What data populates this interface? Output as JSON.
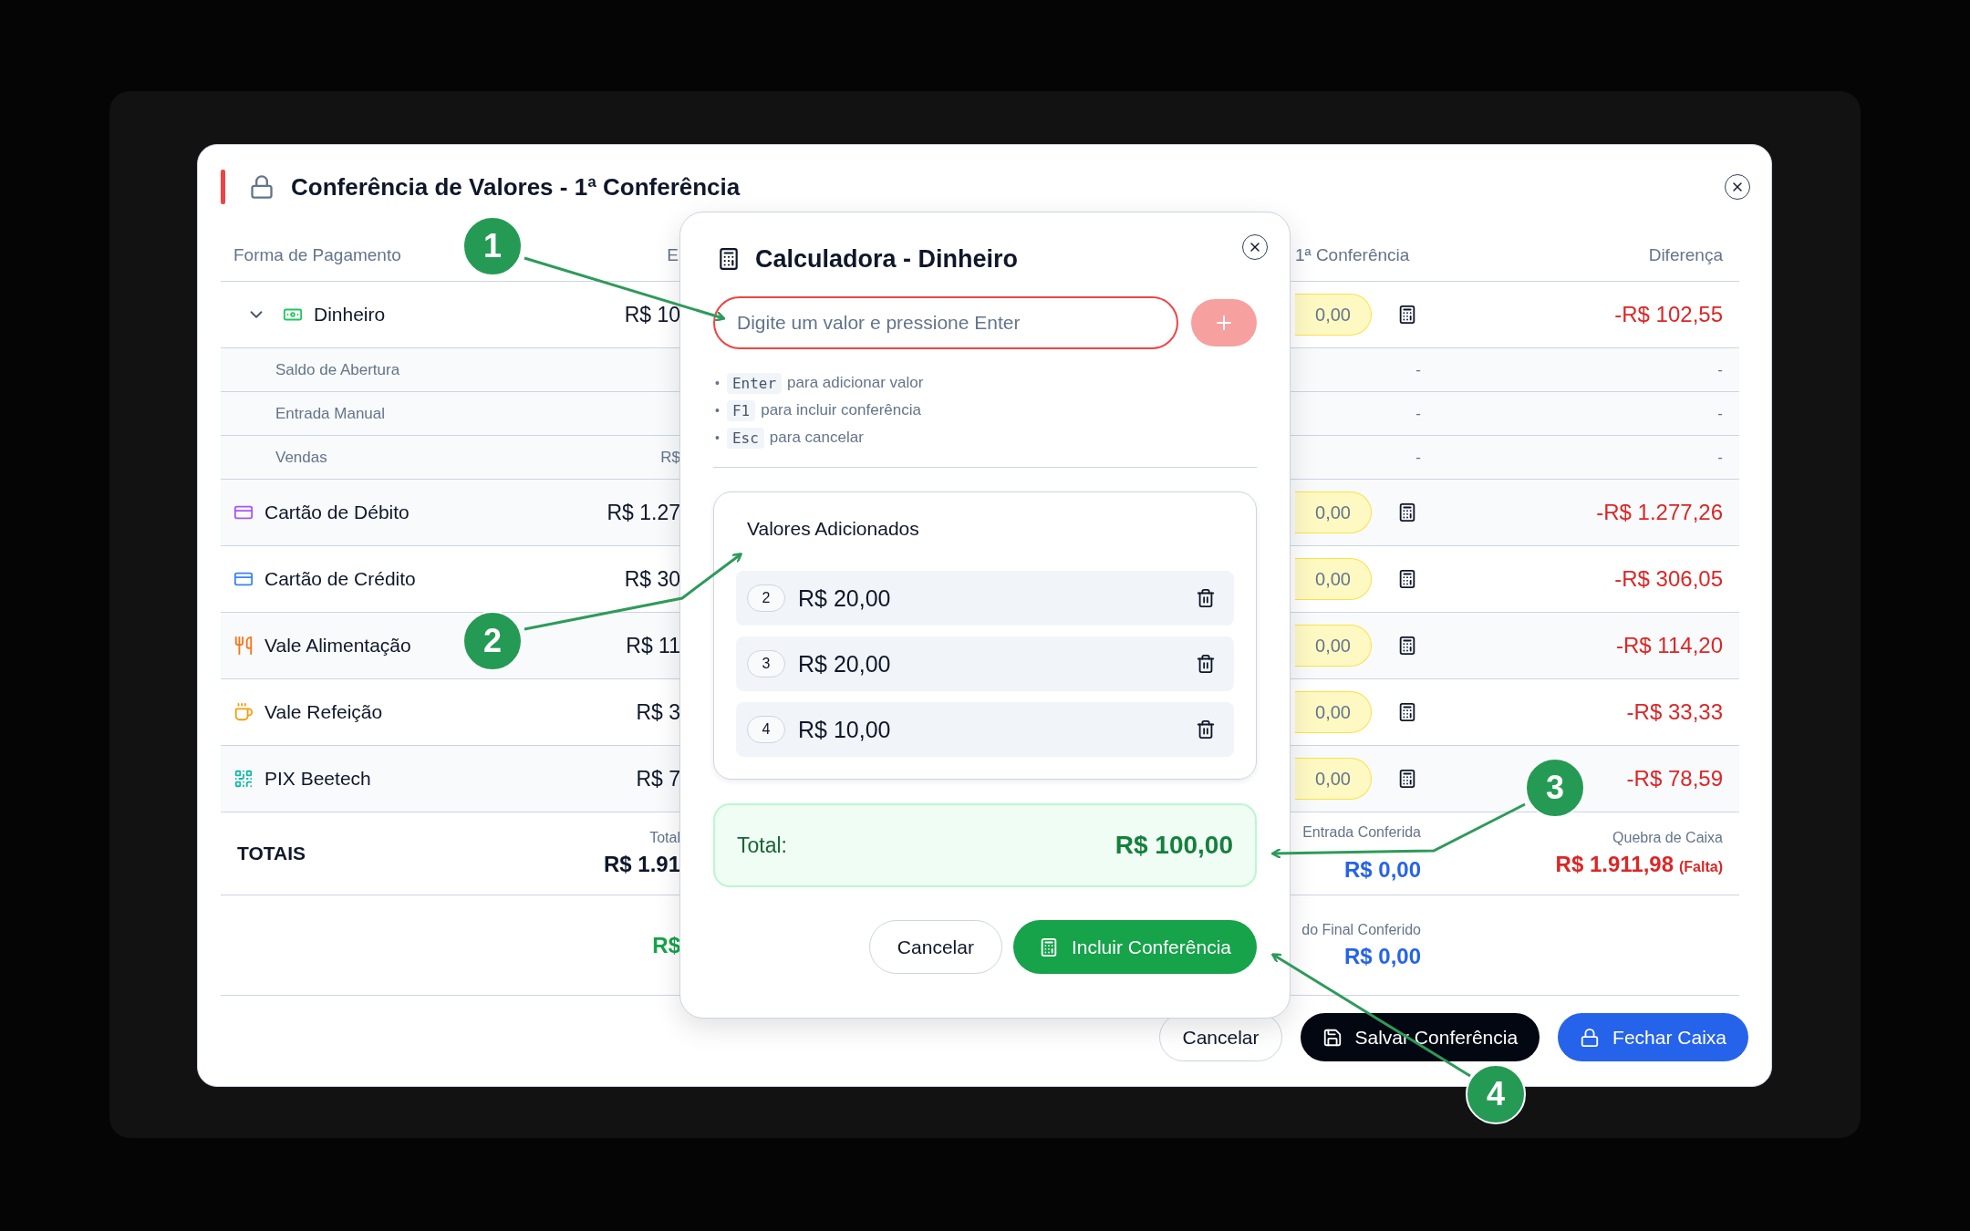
{
  "dialog": {
    "title": "Conferência de Valores - 1ª Conferência"
  },
  "table": {
    "columns": [
      {
        "label": "Forma de Pagamento"
      },
      {
        "label": "E"
      },
      {
        "label": "1ª Conferência"
      },
      {
        "label": "Diferença"
      }
    ],
    "rows": [
      {
        "kind": "method",
        "name": "Dinheiro",
        "color": "#22c55e",
        "expanded": true,
        "expected": "R$ 10",
        "counted": "0,00",
        "difference": "-R$ 102,55"
      },
      {
        "kind": "detail",
        "name": "Saldo de Abertura",
        "counted": "-",
        "difference": "-"
      },
      {
        "kind": "detail",
        "name": "Entrada Manual",
        "counted": "-",
        "difference": "-"
      },
      {
        "kind": "detail",
        "name": "Vendas",
        "expected": "R$",
        "counted": "-",
        "difference": "-"
      },
      {
        "kind": "method",
        "name": "Cartão de Débito",
        "color": "#a855f7",
        "expected": "R$ 1.27",
        "counted": "0,00",
        "difference": "-R$ 1.277,26"
      },
      {
        "kind": "method",
        "name": "Cartão de Crédito",
        "color": "#3b82f6",
        "expected": "R$ 30",
        "counted": "0,00",
        "difference": "-R$ 306,05"
      },
      {
        "kind": "method",
        "name": "Vale Alimentação",
        "color": "#f97316",
        "expected": "R$ 11",
        "counted": "0,00",
        "difference": "-R$ 114,20"
      },
      {
        "kind": "method",
        "name": "Vale Refeição",
        "color": "#f59e0b",
        "expected": "R$ 3",
        "counted": "0,00",
        "difference": "-R$ 33,33"
      },
      {
        "kind": "method",
        "name": "PIX Beetech",
        "color": "#14b8a6",
        "expected": "R$ 7",
        "counted": "0,00",
        "difference": "-R$ 78,59"
      }
    ],
    "totals": {
      "label": "TOTAIS",
      "expected_caption": "Total",
      "expected": "R$ 1.91",
      "counted_caption": "Entrada Conferida",
      "counted": "R$ 0,00",
      "difference_caption": "Quebra de Caixa",
      "difference": "R$ 1.911,98",
      "difference_note": "(Falta)"
    },
    "final": {
      "expected": "R$",
      "counted_caption": "do Final Conferido",
      "counted": "R$ 0,00"
    }
  },
  "footer_buttons": [
    {
      "kind": "secondary",
      "label": "Cancelar"
    },
    {
      "kind": "dark",
      "label": "Salvar Conferência"
    },
    {
      "kind": "primary",
      "label": "Fechar Caixa"
    }
  ],
  "calculator": {
    "title": "Calculadora - Dinheiro",
    "input": {
      "placeholder": "Digite um valor e pressione Enter"
    },
    "add_button": {
      "disabled": true
    },
    "hints": [
      {
        "marker": "•",
        "key": "Enter",
        "text": "para adicionar valor"
      },
      {
        "marker": "•",
        "key": "F1",
        "text": "para incluir conferência"
      },
      {
        "marker": "•",
        "key": "Esc",
        "text": "para cancelar"
      }
    ],
    "values_title": "Valores Adicionados",
    "values": [
      {
        "index": "2",
        "amount": "R$ 20,00"
      },
      {
        "index": "3",
        "amount": "R$ 20,00"
      },
      {
        "index": "4",
        "amount": "R$ 10,00"
      }
    ],
    "total": {
      "label": "Total:",
      "value": "R$ 100,00"
    },
    "buttons": [
      {
        "kind": "secondary",
        "label": "Cancelar"
      },
      {
        "kind": "success",
        "label": "Incluir Conferência"
      }
    ]
  },
  "annotations": [
    {
      "label": "1"
    },
    {
      "label": "2"
    },
    {
      "label": "3"
    },
    {
      "label": "4"
    }
  ]
}
